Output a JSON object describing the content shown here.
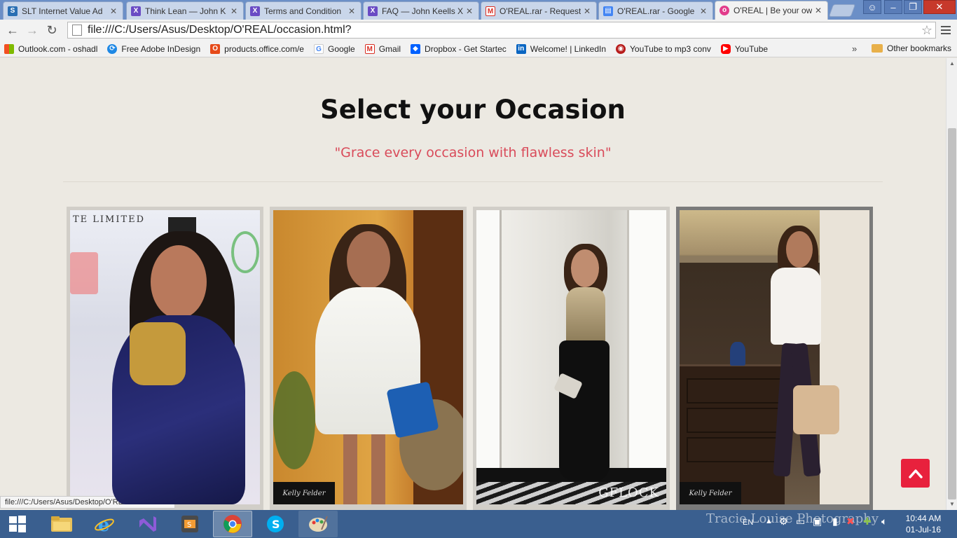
{
  "browser": {
    "tabs": [
      {
        "title": "SLT Internet Value Ad",
        "icon": "slt-icon",
        "color": "#2a6fb3"
      },
      {
        "title": "Think Lean — John K",
        "icon": "x-icon",
        "color": "#6a4bc4"
      },
      {
        "title": "Terms and Condition",
        "icon": "x-icon",
        "color": "#6a4bc4"
      },
      {
        "title": "FAQ — John Keells X",
        "icon": "x-icon",
        "color": "#6a4bc4"
      },
      {
        "title": "O'REAL.rar - Request",
        "icon": "gmail-icon",
        "color": "#d93025"
      },
      {
        "title": "O'REAL.rar - Google",
        "icon": "docs-icon",
        "color": "#4285f4"
      },
      {
        "title": "O'REAL | Be your own",
        "icon": "oreal-icon",
        "color": "#e23c8b"
      }
    ],
    "url": "file:///C:/Users/Asus/Desktop/O'REAL/occasion.html?",
    "bookmarks": [
      {
        "label": "Outlook.com - oshadl",
        "icon": "windows-icon",
        "color": "#f25022"
      },
      {
        "label": "Free Adobe InDesign",
        "icon": "sync-icon",
        "color": "#1e88e5"
      },
      {
        "label": "products.office.com/e",
        "icon": "office-icon",
        "color": "#e64a19"
      },
      {
        "label": "Google",
        "icon": "google-icon",
        "color": "#4285f4"
      },
      {
        "label": "Gmail",
        "icon": "gmail-icon",
        "color": "#d93025"
      },
      {
        "label": "Dropbox - Get Startec",
        "icon": "dropbox-icon",
        "color": "#0061ff"
      },
      {
        "label": "Welcome! | LinkedIn",
        "icon": "linkedin-icon",
        "color": "#0a66c2"
      },
      {
        "label": "YouTube to mp3 conv",
        "icon": "record-icon",
        "color": "#b71c1c"
      },
      {
        "label": "YouTube",
        "icon": "youtube-icon",
        "color": "#ff0000"
      }
    ],
    "more_bookmarks": "»",
    "other_bookmarks": "Other bookmarks",
    "status_url": "file:///C:/Users/Asus/Desktop/O'REAL/dress.html"
  },
  "page": {
    "title": "Select your Occasion",
    "subtitle": "\"Grace every occasion with flawless skin\"",
    "occasions": [
      {
        "tag": "TE LIMITED",
        "logo": "",
        "watermark": ""
      },
      {
        "tag": "",
        "logo": "Kelly Felder",
        "watermark": ""
      },
      {
        "tag": "",
        "logo": "",
        "watermark": "GFLOCK"
      },
      {
        "tag": "",
        "logo": "Kelly Felder",
        "watermark": ""
      }
    ]
  },
  "taskbar": {
    "language": "EN",
    "time": "10:44 AM",
    "date": "01-Jul-16",
    "watermark": "Tracie Louise Photography"
  },
  "colors": {
    "accent": "#e8213d",
    "subtitle": "#d94b5a",
    "page_bg": "#ece9e2"
  }
}
